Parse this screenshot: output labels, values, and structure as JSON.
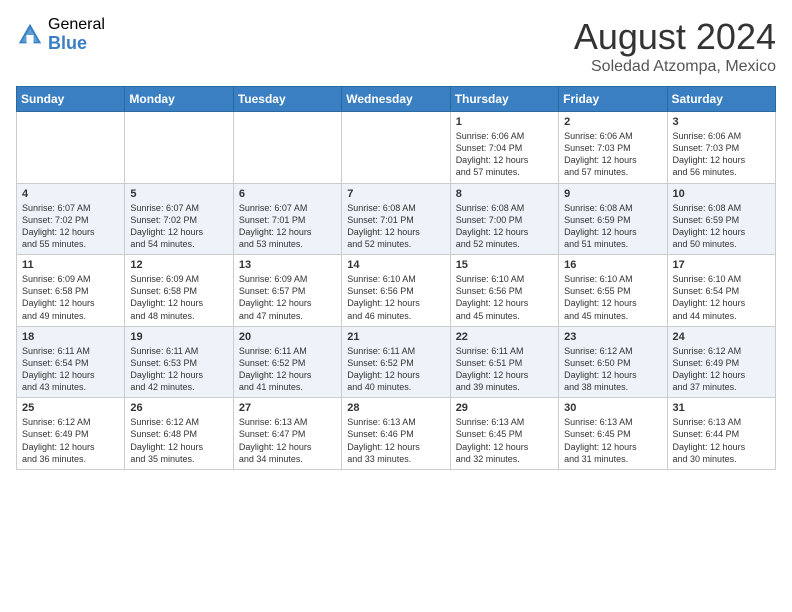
{
  "header": {
    "logo_general": "General",
    "logo_blue": "Blue",
    "month_year": "August 2024",
    "location": "Soledad Atzompa, Mexico"
  },
  "weekdays": [
    "Sunday",
    "Monday",
    "Tuesday",
    "Wednesday",
    "Thursday",
    "Friday",
    "Saturday"
  ],
  "weeks": [
    [
      {
        "day": "",
        "info": ""
      },
      {
        "day": "",
        "info": ""
      },
      {
        "day": "",
        "info": ""
      },
      {
        "day": "",
        "info": ""
      },
      {
        "day": "1",
        "info": "Sunrise: 6:06 AM\nSunset: 7:04 PM\nDaylight: 12 hours\nand 57 minutes."
      },
      {
        "day": "2",
        "info": "Sunrise: 6:06 AM\nSunset: 7:03 PM\nDaylight: 12 hours\nand 57 minutes."
      },
      {
        "day": "3",
        "info": "Sunrise: 6:06 AM\nSunset: 7:03 PM\nDaylight: 12 hours\nand 56 minutes."
      }
    ],
    [
      {
        "day": "4",
        "info": "Sunrise: 6:07 AM\nSunset: 7:02 PM\nDaylight: 12 hours\nand 55 minutes."
      },
      {
        "day": "5",
        "info": "Sunrise: 6:07 AM\nSunset: 7:02 PM\nDaylight: 12 hours\nand 54 minutes."
      },
      {
        "day": "6",
        "info": "Sunrise: 6:07 AM\nSunset: 7:01 PM\nDaylight: 12 hours\nand 53 minutes."
      },
      {
        "day": "7",
        "info": "Sunrise: 6:08 AM\nSunset: 7:01 PM\nDaylight: 12 hours\nand 52 minutes."
      },
      {
        "day": "8",
        "info": "Sunrise: 6:08 AM\nSunset: 7:00 PM\nDaylight: 12 hours\nand 52 minutes."
      },
      {
        "day": "9",
        "info": "Sunrise: 6:08 AM\nSunset: 6:59 PM\nDaylight: 12 hours\nand 51 minutes."
      },
      {
        "day": "10",
        "info": "Sunrise: 6:08 AM\nSunset: 6:59 PM\nDaylight: 12 hours\nand 50 minutes."
      }
    ],
    [
      {
        "day": "11",
        "info": "Sunrise: 6:09 AM\nSunset: 6:58 PM\nDaylight: 12 hours\nand 49 minutes."
      },
      {
        "day": "12",
        "info": "Sunrise: 6:09 AM\nSunset: 6:58 PM\nDaylight: 12 hours\nand 48 minutes."
      },
      {
        "day": "13",
        "info": "Sunrise: 6:09 AM\nSunset: 6:57 PM\nDaylight: 12 hours\nand 47 minutes."
      },
      {
        "day": "14",
        "info": "Sunrise: 6:10 AM\nSunset: 6:56 PM\nDaylight: 12 hours\nand 46 minutes."
      },
      {
        "day": "15",
        "info": "Sunrise: 6:10 AM\nSunset: 6:56 PM\nDaylight: 12 hours\nand 45 minutes."
      },
      {
        "day": "16",
        "info": "Sunrise: 6:10 AM\nSunset: 6:55 PM\nDaylight: 12 hours\nand 45 minutes."
      },
      {
        "day": "17",
        "info": "Sunrise: 6:10 AM\nSunset: 6:54 PM\nDaylight: 12 hours\nand 44 minutes."
      }
    ],
    [
      {
        "day": "18",
        "info": "Sunrise: 6:11 AM\nSunset: 6:54 PM\nDaylight: 12 hours\nand 43 minutes."
      },
      {
        "day": "19",
        "info": "Sunrise: 6:11 AM\nSunset: 6:53 PM\nDaylight: 12 hours\nand 42 minutes."
      },
      {
        "day": "20",
        "info": "Sunrise: 6:11 AM\nSunset: 6:52 PM\nDaylight: 12 hours\nand 41 minutes."
      },
      {
        "day": "21",
        "info": "Sunrise: 6:11 AM\nSunset: 6:52 PM\nDaylight: 12 hours\nand 40 minutes."
      },
      {
        "day": "22",
        "info": "Sunrise: 6:11 AM\nSunset: 6:51 PM\nDaylight: 12 hours\nand 39 minutes."
      },
      {
        "day": "23",
        "info": "Sunrise: 6:12 AM\nSunset: 6:50 PM\nDaylight: 12 hours\nand 38 minutes."
      },
      {
        "day": "24",
        "info": "Sunrise: 6:12 AM\nSunset: 6:49 PM\nDaylight: 12 hours\nand 37 minutes."
      }
    ],
    [
      {
        "day": "25",
        "info": "Sunrise: 6:12 AM\nSunset: 6:49 PM\nDaylight: 12 hours\nand 36 minutes."
      },
      {
        "day": "26",
        "info": "Sunrise: 6:12 AM\nSunset: 6:48 PM\nDaylight: 12 hours\nand 35 minutes."
      },
      {
        "day": "27",
        "info": "Sunrise: 6:13 AM\nSunset: 6:47 PM\nDaylight: 12 hours\nand 34 minutes."
      },
      {
        "day": "28",
        "info": "Sunrise: 6:13 AM\nSunset: 6:46 PM\nDaylight: 12 hours\nand 33 minutes."
      },
      {
        "day": "29",
        "info": "Sunrise: 6:13 AM\nSunset: 6:45 PM\nDaylight: 12 hours\nand 32 minutes."
      },
      {
        "day": "30",
        "info": "Sunrise: 6:13 AM\nSunset: 6:45 PM\nDaylight: 12 hours\nand 31 minutes."
      },
      {
        "day": "31",
        "info": "Sunrise: 6:13 AM\nSunset: 6:44 PM\nDaylight: 12 hours\nand 30 minutes."
      }
    ]
  ]
}
